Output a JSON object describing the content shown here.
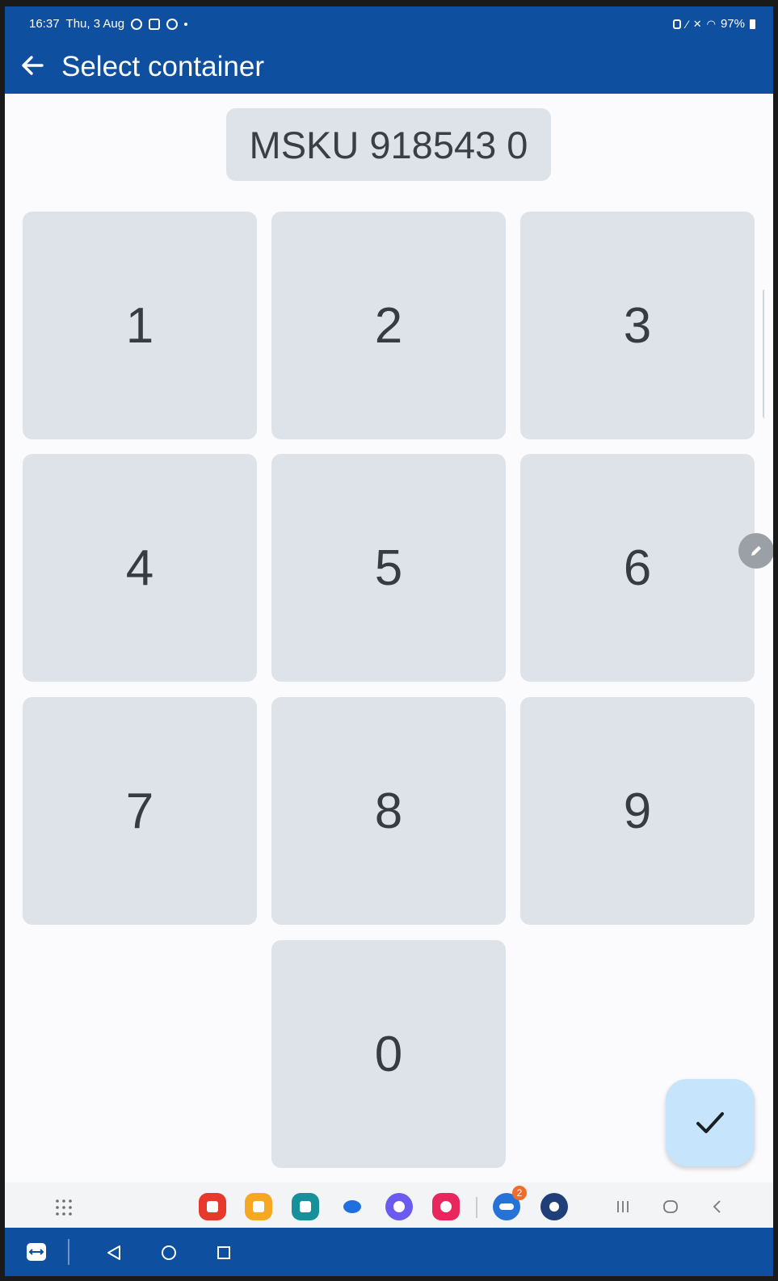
{
  "status_bar": {
    "time": "16:37",
    "date": "Thu, 3 Aug",
    "battery": "97%"
  },
  "app_bar": {
    "title": "Select container"
  },
  "container_display": {
    "value": "MSKU 918543 0"
  },
  "keypad": {
    "keys": [
      "1",
      "2",
      "3",
      "4",
      "5",
      "6",
      "7",
      "8",
      "9",
      "0"
    ]
  },
  "taskbar": {
    "notification_badge": "2"
  },
  "colors": {
    "primary": "#0e4fa0",
    "key_bg": "#dde3e9",
    "fab_bg": "#c6e4fb"
  }
}
